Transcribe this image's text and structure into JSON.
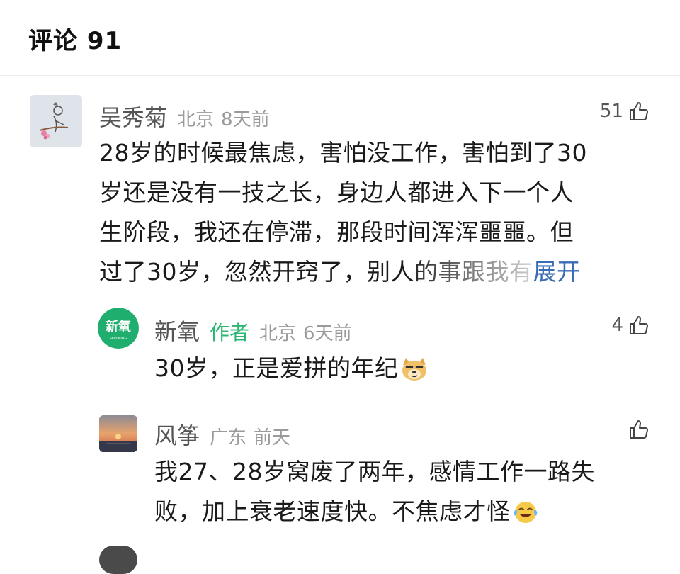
{
  "header": {
    "title": "评论 91"
  },
  "comments": [
    {
      "name": "吴秀菊",
      "location": "北京",
      "time": "8天前",
      "likes": "51",
      "lines": [
        "28岁的时候最焦虑，害怕没工作，害怕到了30",
        "岁还是没有一技之长，身边人都进入下一个人",
        "生阶段，我还在停滞，那段时间浑浑噩噩。但",
        "过了30岁，忽然开窍了，别人的事跟我有"
      ],
      "expand_label": "展开"
    }
  ],
  "replies": [
    {
      "name": "新氧",
      "author_tag": "作者",
      "location": "北京",
      "time": "6天前",
      "likes": "4",
      "text": "30岁，正是爱拼的年纪",
      "emoji": "doge-emoji",
      "avatar_logo": "新氧",
      "avatar_logo_sub": "SOYOUNG"
    },
    {
      "name": "风筝",
      "location": "广东",
      "time": "前天",
      "likes": "",
      "lines": [
        "我27、28岁窝废了两年，感情工作一路失",
        "败，加上衰老速度快。不焦虑才怪"
      ],
      "emoji": "laugh-cry-emoji"
    }
  ],
  "colors": {
    "author_tag": "#2bb673",
    "expand_link": "#3a6bb5",
    "meta_gray": "#9a9a9a",
    "logo_green": "#1fae6e"
  },
  "icons": {
    "like": "thumbs-up-icon"
  }
}
